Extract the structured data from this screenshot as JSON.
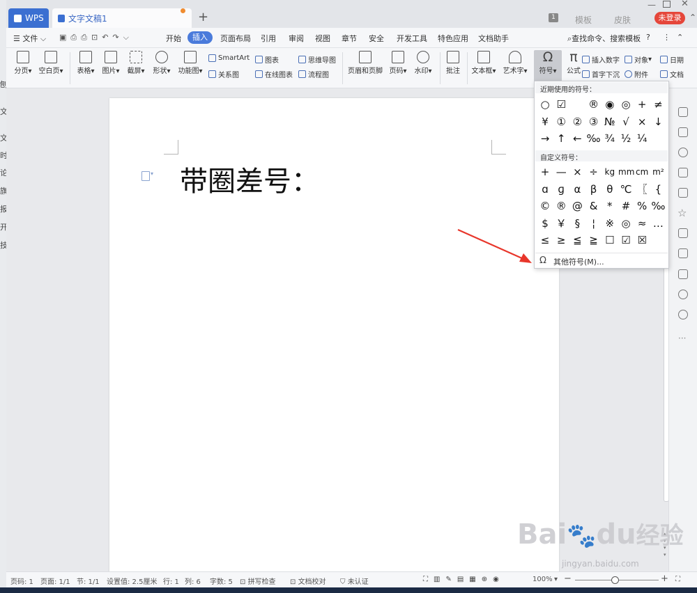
{
  "app": {
    "tabs": [
      {
        "label": "WPS"
      },
      {
        "label": "文字文稿1"
      }
    ],
    "titlebar_right": [
      "模板",
      "皮肤"
    ],
    "page_badge": "1",
    "login_label": "未登录"
  },
  "left_window_chars": [
    "刨",
    "文",
    "文",
    "时",
    "论",
    "旗",
    "报",
    "开",
    "技"
  ],
  "menubar": {
    "file_label": "文件",
    "items": [
      "开始",
      "插入",
      "页面布局",
      "引用",
      "审阅",
      "视图",
      "章节",
      "安全",
      "开发工具",
      "特色应用",
      "文档助手"
    ],
    "active": "插入",
    "search_label": "查找命令、搜索模板",
    "help": "?"
  },
  "ribbon": {
    "big_buttons": [
      "分页",
      "空白页",
      "表格",
      "图片",
      "截屏",
      "形状",
      "功能图",
      "页眉和页脚",
      "页码",
      "水印",
      "批注",
      "文本框",
      "艺术字",
      "符号",
      "公式"
    ],
    "small_buttons": [
      "SmartArt",
      "图表",
      "思维导图",
      "关系图",
      "在线图表",
      "流程图",
      "插入数字",
      "对象",
      "日期",
      "首字下沉",
      "附件",
      "文档"
    ]
  },
  "document": {
    "text": "带圈差号："
  },
  "symbol_dropdown": {
    "recent_title": "近期使用的符号：",
    "recent_symbols": [
      "○",
      "☑",
      "",
      "®",
      "◉",
      "◎",
      "+",
      "≠",
      "¥",
      "①",
      "②",
      "③",
      "№",
      "√",
      "×",
      "↓",
      "→",
      "↑",
      "←",
      "‰",
      "¾",
      "½",
      "¼"
    ],
    "custom_title": "自定义符号：",
    "custom_symbols": [
      "+",
      "—",
      "×",
      "÷",
      "kg",
      "mm",
      "cm",
      "m²",
      "ɑ",
      "ɡ",
      "α",
      "β",
      "θ",
      "℃",
      "〖",
      "{",
      "©",
      "®",
      "@",
      "&",
      "*",
      "#",
      "%",
      "‰",
      "$",
      "￥",
      "§",
      "¦",
      "※",
      "◎",
      "≈",
      "…",
      "≤",
      "≥",
      "≦",
      "≧",
      "☐",
      "☑",
      "☒"
    ],
    "more_label": "其他符号(M)..."
  },
  "statusbar": {
    "items": [
      "页码: 1",
      "页面: 1/1",
      "节: 1/1",
      "设置值: 2.5厘米",
      "行: 1",
      "列: 6",
      "字数: 5",
      "拼写检查",
      "文档校对",
      "未认证"
    ],
    "zoom": "100%"
  },
  "watermark": {
    "brand": "Bai",
    "brand2": "du",
    "cn": "经验",
    "url": "jingyan.baidu.com"
  },
  "colors": {
    "accent": "#4a7bdb",
    "login": "#e5463a",
    "arrow": "#e8362b"
  }
}
